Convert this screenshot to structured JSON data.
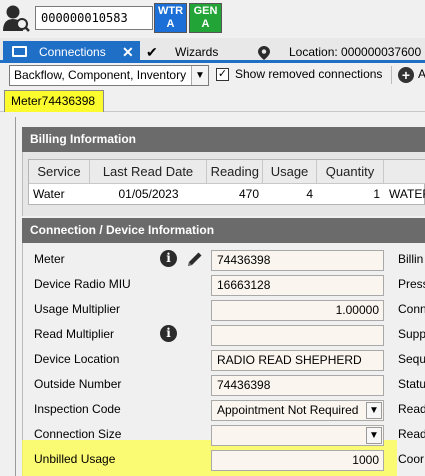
{
  "header": {
    "account_number": "000000010583",
    "badges": [
      {
        "line1": "WTR",
        "line2": "A",
        "color": "#1c6fd6"
      },
      {
        "line1": "GEN",
        "line2": "A",
        "color": "#22a436"
      }
    ]
  },
  "tabs": {
    "connections": "Connections",
    "close_glyph": "✕",
    "wizards": "Wizards",
    "location": "Location: 000000037600"
  },
  "toolbar": {
    "filter_value": "Backflow, Component, Inventory",
    "show_removed_label": "Show removed connections",
    "show_removed_checked": true,
    "add_label": "A"
  },
  "meter_tab": {
    "label": "Meter74436398",
    "color": "#fbfb2e"
  },
  "billing": {
    "title": "Billing Information",
    "columns": [
      "Service",
      "Last Read Date",
      "Reading",
      "Usage",
      "Quantity"
    ],
    "rows": [
      {
        "service": "Water",
        "last_read_date": "01/05/2023",
        "reading": "470",
        "usage": "4",
        "quantity": "1",
        "extra": "WATER"
      }
    ]
  },
  "device": {
    "title": "Connection / Device Information",
    "fields": [
      {
        "label": "Meter",
        "value": "74436398"
      },
      {
        "label": "Device Radio MIU",
        "value": "16663128"
      },
      {
        "label": "Usage Multiplier",
        "value": "1.00000"
      },
      {
        "label": "Read Multiplier",
        "value": ""
      },
      {
        "label": "Device Location",
        "value": "RADIO READ SHEPHERD"
      },
      {
        "label": "Outside Number",
        "value": "74436398"
      },
      {
        "label": "Inspection Code",
        "value": "Appointment Not Required"
      },
      {
        "label": "Connection Size",
        "value": ""
      },
      {
        "label": "Unbilled Usage",
        "value": "1000"
      }
    ],
    "right_labels": [
      "Billin",
      "Press",
      "Conn",
      "Supp",
      "Sequ",
      "Statu",
      "Read",
      "Read",
      "Coor"
    ]
  },
  "colors": {
    "accent": "#1f6fc7",
    "section_header": "#6b6b6b",
    "highlight": "#fdfd4a",
    "field_bg": "#faf5ee"
  }
}
